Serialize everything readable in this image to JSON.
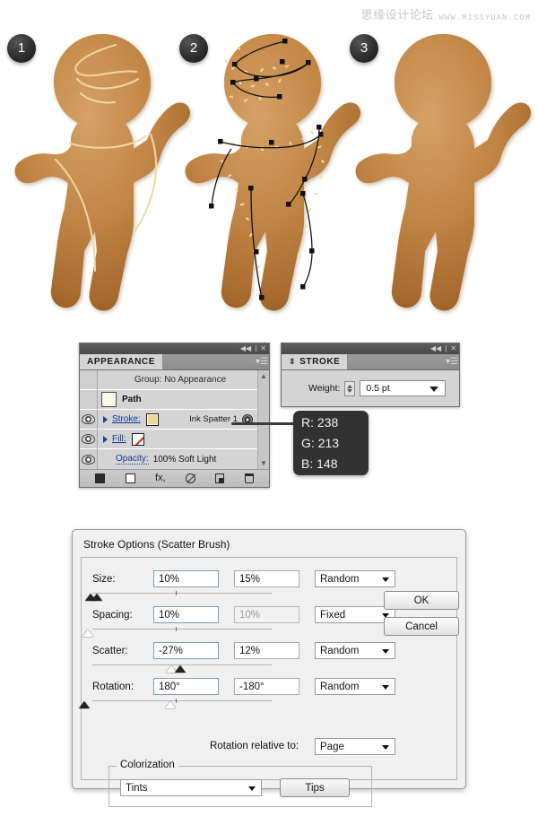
{
  "watermark": {
    "cn": "思缘设计论坛",
    "url": "WWW.MISSYUAN.COM"
  },
  "illustration": {
    "badges": [
      {
        "label": "1"
      },
      {
        "label": "2"
      },
      {
        "label": "3"
      }
    ],
    "figure_description": "gingerbread-man cookie",
    "colors": {
      "cookie_light": "#d49a5c",
      "cookie_mid": "#c08243",
      "cookie_dark": "#9b5f28",
      "icing": "#f4d9a4",
      "path_stroke": "#1a1a1a"
    }
  },
  "appearance_panel": {
    "topbar": {
      "collapse": "◀◀",
      "divider": "|",
      "close": "✕"
    },
    "tab_label": "APPEARANCE",
    "menu_glyph": "▾☰",
    "rows": {
      "group_header": "Group: No Appearance",
      "path_label": "Path",
      "stroke_label": "Stroke:",
      "stroke_brush": "Ink Spatter 1",
      "stroke_color": "#f0d594",
      "fill_label": "Fill:",
      "fill_value": "None",
      "opacity_label": "Opacity:",
      "opacity_value": "100% Soft Light"
    },
    "footer_icons": [
      "new-stroke-icon",
      "new-fill-icon",
      "add-effect-fx-icon",
      "clear-appearance-icon",
      "duplicate-item-icon",
      "delete-item-icon"
    ]
  },
  "stroke_panel": {
    "topbar": {
      "collapse": "◀◀",
      "divider": "|",
      "close": "✕"
    },
    "tab_label": "STROKE",
    "tab_grip": "⇕",
    "menu_glyph": "▾☰",
    "weight_label": "Weight:",
    "weight_value": "0.5 pt"
  },
  "rgb_tooltip": {
    "lines": [
      "R: 238",
      "G: 213",
      "B: 148"
    ],
    "hex": "#EED594"
  },
  "dialog": {
    "title": "Stroke Options (Scatter Brush)",
    "buttons": {
      "ok": "OK",
      "cancel": "Cancel",
      "tips": "Tips"
    },
    "fields": [
      {
        "label": "Size:",
        "value_a": "10%",
        "value_b": "15%",
        "mode": "Random",
        "b_dim": false,
        "handles": [
          {
            "pos": 4,
            "solid": true
          },
          {
            "pos": 11,
            "solid": true
          }
        ],
        "tick": 93
      },
      {
        "label": "Spacing:",
        "value_a": "10%",
        "value_b": "10%",
        "mode": "Fixed",
        "b_dim": true,
        "handles": [
          {
            "pos": 1,
            "solid": false
          }
        ],
        "tick": 93
      },
      {
        "label": "Scatter:",
        "value_a": "-27%",
        "value_b": "12%",
        "mode": "Random",
        "b_dim": false,
        "handles": [
          {
            "pos": 94,
            "solid": false
          },
          {
            "pos": 104,
            "solid": true
          }
        ],
        "tick": -1
      },
      {
        "label": "Rotation:",
        "value_a": "180°",
        "value_b": "-180°",
        "mode": "Random",
        "b_dim": false,
        "handles": [
          {
            "pos": -3,
            "solid": true
          },
          {
            "pos": 93,
            "solid": false
          }
        ],
        "tick": 93
      }
    ],
    "rotation_relative_label": "Rotation relative to:",
    "rotation_relative_value": "Page",
    "colorization_legend": "Colorization",
    "colorization_value": "Tints"
  }
}
